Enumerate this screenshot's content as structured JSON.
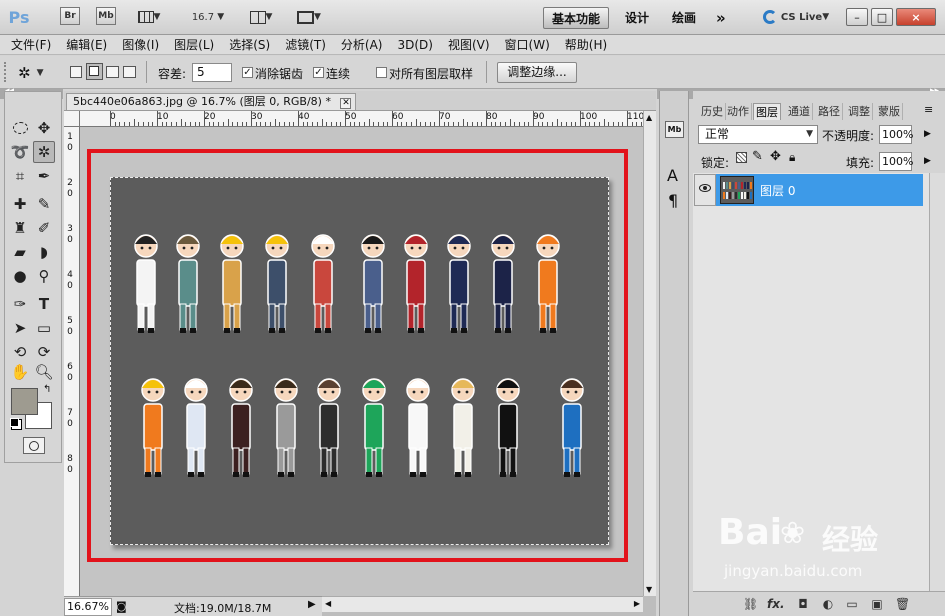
{
  "app": {
    "logo": "Ps",
    "br_btn": "Br",
    "mb_btn": "Mb",
    "zoom_value": "16.7",
    "workspaces": [
      "基本功能",
      "设计",
      "绘画"
    ],
    "more": "»",
    "cslive": "CS Live",
    "win_buttons": [
      "–",
      "□",
      "×"
    ]
  },
  "menu": [
    "文件(F)",
    "编辑(E)",
    "图像(I)",
    "图层(L)",
    "选择(S)",
    "滤镜(T)",
    "分析(A)",
    "3D(D)",
    "视图(V)",
    "窗口(W)",
    "帮助(H)"
  ],
  "options": {
    "tolerance_label": "容差:",
    "tolerance_value": "5",
    "antialias_label": "消除锯齿",
    "contiguous_label": "连续",
    "sample_all_label": "对所有图层取样",
    "refine_edge_button": "调整边缘..."
  },
  "document": {
    "tab_title": "5bc440e06a863.jpg @ 16.7% (图层 0, RGB/8) *",
    "zoom": "16.67%",
    "doc_info": "文档:19.0M/18.7M",
    "ruler_top": [
      "0",
      "10",
      "20",
      "30",
      "40",
      "50",
      "60",
      "70",
      "80",
      "90",
      "100",
      "110"
    ],
    "ruler_left": [
      "1",
      "0",
      "2",
      "0",
      "3",
      "0",
      "4",
      "0",
      "5",
      "0",
      "6",
      "0",
      "7",
      "0",
      "8",
      "0"
    ]
  },
  "layers_panel": {
    "tabs": [
      "历史",
      "动作",
      "图层",
      "通道",
      "路径",
      "调整",
      "蒙版"
    ],
    "active_tab": "图层",
    "blend_mode": "正常",
    "opacity_label": "不透明度:",
    "opacity_value": "100%",
    "lock_label": "锁定:",
    "fill_label": "填充:",
    "fill_value": "100%",
    "layer_name": "图层 0"
  },
  "watermark": {
    "brand": "Bai",
    "brand_suffix": "经验",
    "url": "jingyan.baidu.com"
  },
  "colors": {
    "selection_highlight": "#3d9ae8",
    "red_frame": "#e2131b",
    "canvas_bg": "#5c5c5c",
    "ps_logo": "#6fa4d9"
  }
}
